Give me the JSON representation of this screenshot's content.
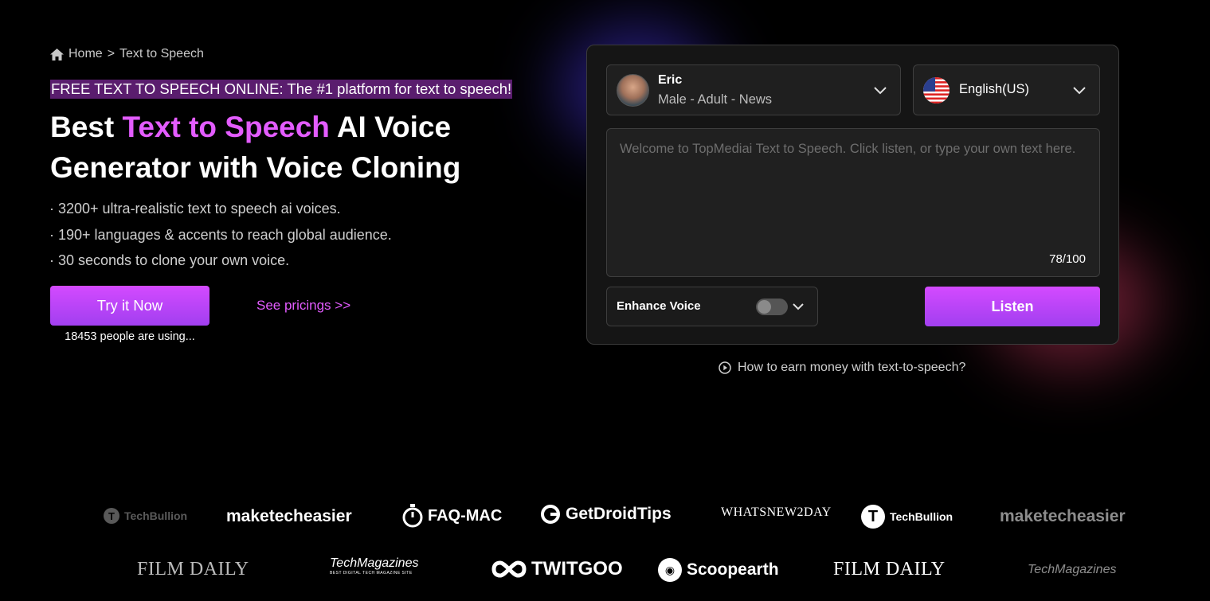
{
  "breadcrumb": {
    "home": "Home",
    "separator": ">",
    "current": "Text to Speech"
  },
  "hero": {
    "tagline": "FREE TEXT TO SPEECH ONLINE: The #1 platform for text to speech!",
    "headline_prefix": "Best ",
    "headline_accent": "Text to Speech",
    "headline_line1_suffix": " AI Voice",
    "headline_line2": "Generator with Voice Cloning",
    "accent_color": "#e35cff",
    "features": [
      "· 3200+ ultra-realistic text to speech ai voices.",
      "· 190+ languages & accents to reach global audience.",
      "· 30 seconds to clone your own voice."
    ],
    "try_button": "Try it Now",
    "using_text": "18453 people are using...",
    "pricing_link": "See pricings >>"
  },
  "panel": {
    "voice": {
      "name": "Eric",
      "description": "Male - Adult - News"
    },
    "language": {
      "label": "English(US)",
      "flag": "us-flag-icon"
    },
    "textarea": {
      "placeholder": "Welcome to TopMediai Text to Speech. Click listen, or type your own text here.",
      "value": ""
    },
    "char_count": "78/100",
    "enhance_label": "Enhance Voice",
    "enhance_enabled": false,
    "listen_button": "Listen"
  },
  "earn_link": "How to earn money with text-to-speech?",
  "logos": {
    "row1": [
      "TechBullion",
      "maketecheasier",
      "FAQ-MAC",
      "GetDroidTips",
      "WHATSNEW2DAY",
      "TechBullion",
      "maketecheasier"
    ],
    "row2": [
      "FILM DAILY",
      "TechMagazines",
      "TWITGOO",
      "Scoopearth",
      "FILM DAILY",
      "TechMagazines"
    ],
    "techmagazines_tagline": "BEST DIGITAL TECH MAGAZINE SITE"
  }
}
